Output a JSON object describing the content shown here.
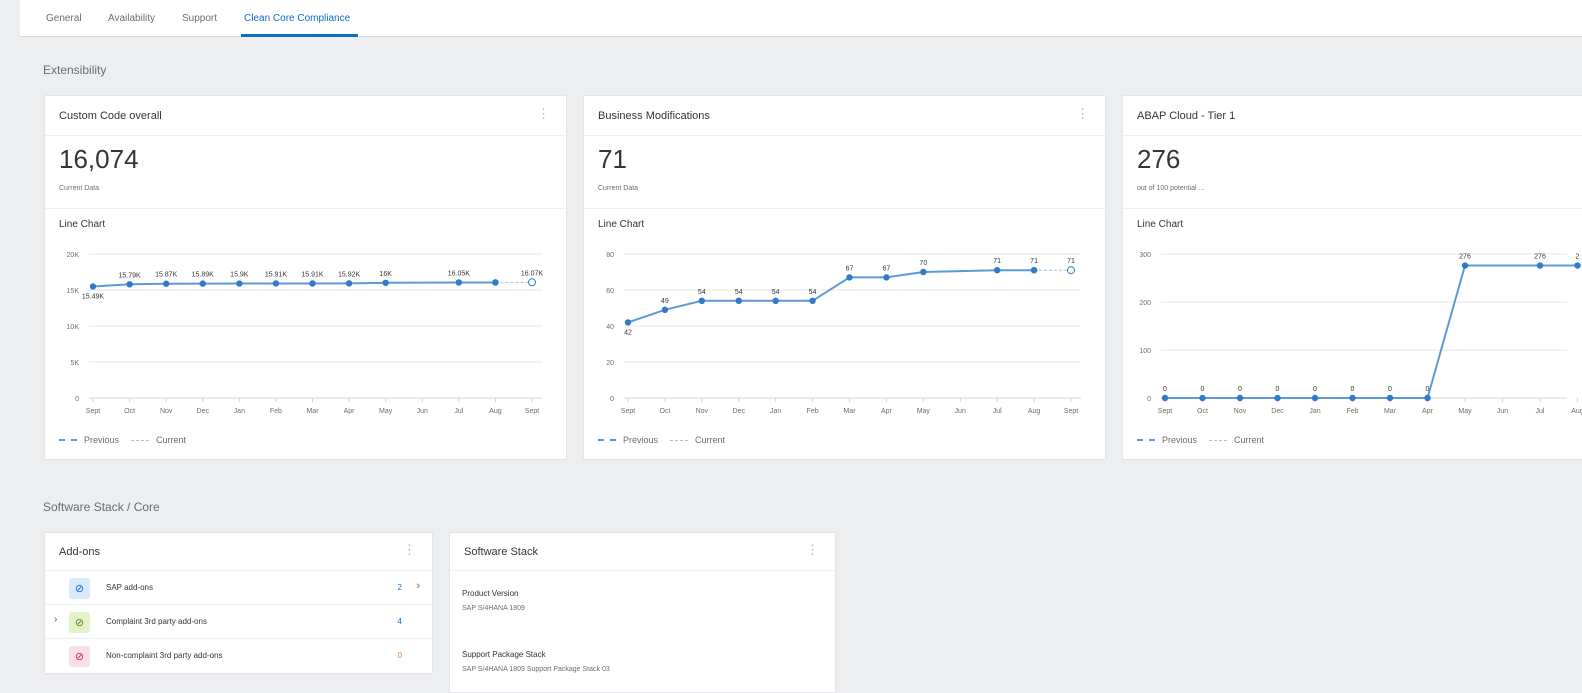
{
  "tabs": [
    {
      "label": "General"
    },
    {
      "label": "Availability"
    },
    {
      "label": "Support"
    },
    {
      "label": "Clean Core Compliance",
      "active": true
    }
  ],
  "sections": {
    "extensibility": "Extensibility",
    "software_stack": "Software Stack / Core"
  },
  "cards": [
    {
      "title": "Custom Code overall",
      "value": "16,074",
      "subtitle": "Current Data",
      "chart_label": "Line Chart"
    },
    {
      "title": "Business Modifications",
      "value": "71",
      "subtitle": "Current Data",
      "chart_label": "Line Chart"
    },
    {
      "title": "ABAP Cloud - Tier 1",
      "value": "276",
      "subtitle": "out of 100 potential ...",
      "chart_label": "Line Chart"
    }
  ],
  "legend": {
    "previous": "Previous",
    "current": "Current"
  },
  "chart_data": [
    {
      "type": "line",
      "categories": [
        "Sept",
        "Oct",
        "Nov",
        "Dec",
        "Jan",
        "Feb",
        "Mar",
        "Apr",
        "May",
        "Jun",
        "Jul",
        "Aug",
        "Sept"
      ],
      "yticks": [
        "0",
        "5K",
        "10K",
        "15K",
        "20K"
      ],
      "ylim": [
        0,
        20000
      ],
      "series": [
        {
          "name": "Previous",
          "values": [
            15490,
            15790,
            15870,
            15890,
            15900,
            15910,
            15910,
            15920,
            16000,
            null,
            16050,
            16050,
            null
          ],
          "labels": [
            "15.49K",
            "15.79K",
            "15.87K",
            "15.89K",
            "15.9K",
            "15.91K",
            "15.91K",
            "15.92K",
            "16K",
            "",
            "16.05K",
            "",
            ""
          ]
        },
        {
          "name": "Current",
          "values": [
            null,
            null,
            null,
            null,
            null,
            null,
            null,
            null,
            null,
            null,
            null,
            16050,
            16070
          ],
          "labels": [
            "",
            "",
            "",
            "",
            "",
            "",
            "",
            "",
            "",
            "",
            "",
            "",
            "16.07K"
          ]
        }
      ]
    },
    {
      "type": "line",
      "categories": [
        "Sept",
        "Oct",
        "Nov",
        "Dec",
        "Jan",
        "Feb",
        "Mar",
        "Apr",
        "May",
        "Jun",
        "Jul",
        "Aug",
        "Sept"
      ],
      "yticks": [
        "0",
        "20",
        "40",
        "60",
        "80"
      ],
      "ylim": [
        0,
        80
      ],
      "series": [
        {
          "name": "Previous",
          "values": [
            42,
            49,
            54,
            54,
            54,
            54,
            67,
            67,
            70,
            null,
            71,
            71,
            null
          ],
          "labels": [
            "42",
            "49",
            "54",
            "54",
            "54",
            "54",
            "67",
            "67",
            "70",
            "",
            "71",
            "71",
            ""
          ]
        },
        {
          "name": "Current",
          "values": [
            null,
            null,
            null,
            null,
            null,
            null,
            null,
            null,
            null,
            null,
            null,
            71,
            71
          ],
          "labels": [
            "",
            "",
            "",
            "",
            "",
            "",
            "",
            "",
            "",
            "",
            "",
            "",
            "71"
          ]
        }
      ]
    },
    {
      "type": "line",
      "categories": [
        "Sept",
        "Oct",
        "Nov",
        "Dec",
        "Jan",
        "Feb",
        "Mar",
        "Apr",
        "May",
        "Jun",
        "Jul",
        "Aug"
      ],
      "yticks": [
        "0",
        "100",
        "200",
        "300"
      ],
      "ylim": [
        0,
        300
      ],
      "series": [
        {
          "name": "Previous",
          "values": [
            0,
            0,
            0,
            0,
            0,
            0,
            0,
            0,
            276,
            null,
            276,
            276
          ],
          "labels": [
            "0",
            "0",
            "0",
            "0",
            "0",
            "0",
            "0",
            "0",
            "276",
            "",
            "276",
            "2"
          ]
        }
      ]
    }
  ],
  "addons": {
    "title": "Add-ons",
    "items": [
      {
        "label": "SAP add-ons",
        "count": "2",
        "count_color": "#0a6ed1",
        "icon_bg": "#d8eafb",
        "icon_color": "#0a6ed1",
        "icon": "shield-icon",
        "chevron": true,
        "expand": false
      },
      {
        "label": "Complaint 3rd party add-ons",
        "count": "4",
        "count_color": "#0a6ed1",
        "icon_bg": "#e4f1c9",
        "icon_color": "#5b8a1e",
        "icon": "shield-icon",
        "chevron": false,
        "expand": true
      },
      {
        "label": "Non-complaint 3rd party add-ons",
        "count": "0",
        "count_color": "#e9730c",
        "icon_bg": "#fbdde5",
        "icon_color": "#c4285a",
        "icon": "shield-icon",
        "chevron": false,
        "expand": false
      }
    ]
  },
  "software_stack": {
    "title": "Software Stack",
    "product_version_label": "Product Version",
    "product_version": "SAP S/4HANA 1809",
    "support_package_label": "Support Package Stack",
    "support_package": "SAP S/4HANA 1809 Support Package Stack 03"
  },
  "colors": {
    "accent": "#0a6ed1",
    "series": "#5b9bd5"
  }
}
